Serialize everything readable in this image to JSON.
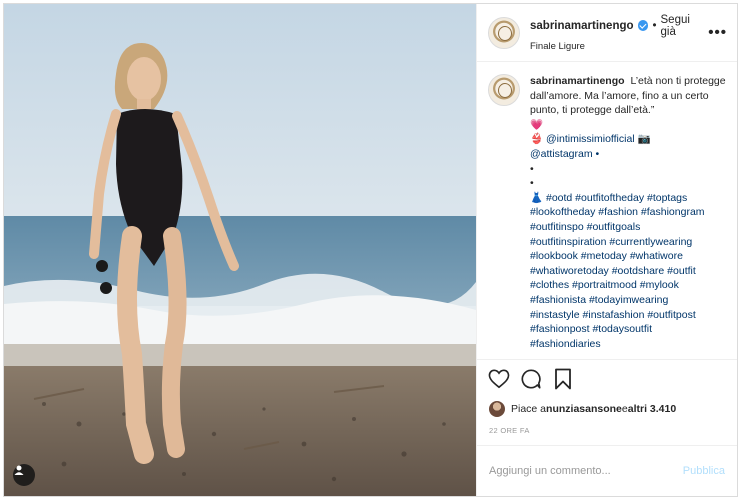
{
  "header": {
    "username": "sabrinamartinengo",
    "separator": "•",
    "follow_status": "Segui già",
    "location": "Finale Ligure",
    "more_icon": "more-horizontal-icon",
    "more_label": "•••"
  },
  "caption": {
    "username": "sabrinamartinengo",
    "lines": [
      "L’età non ti protegge dall’amore. Ma l’amore, fino a un certo punto, ti protegge dall’età.”",
      "💗",
      "👙 @intimissimiofficial 📷",
      "@attistagram •",
      "•",
      "•",
      "👗 #ootd #outfitoftheday #toptags",
      "#lookoftheday #fashion #fashiongram",
      "#outfitinspo #outfitgoals",
      "#outfitinspiration #currentlywearing",
      "#lookbook #metoday #whatiwore",
      "#whatiworetoday #ootdshare #outfit",
      "#clothes #portraitmood #mylook",
      "#fashionista #todayimwearing",
      "#instastyle #instafashion #outfitpost",
      "#fashionpost #todaysoutfit",
      "#fashiondiaries"
    ]
  },
  "actions": {
    "like_icon": "heart-icon",
    "comment_icon": "comment-icon",
    "save_icon": "bookmark-icon"
  },
  "likes": {
    "prefix": "Piace a ",
    "user": "nunziasansone",
    "middle": " e ",
    "others": "altri 3.410"
  },
  "time_ago": "22 ORE FA",
  "comment_box": {
    "placeholder": "Aggiungi un commento...",
    "publish_label": "Pubblica"
  },
  "colors": {
    "link": "#003569",
    "verified": "#3897f0",
    "publish_disabled": "#b2dffc"
  }
}
